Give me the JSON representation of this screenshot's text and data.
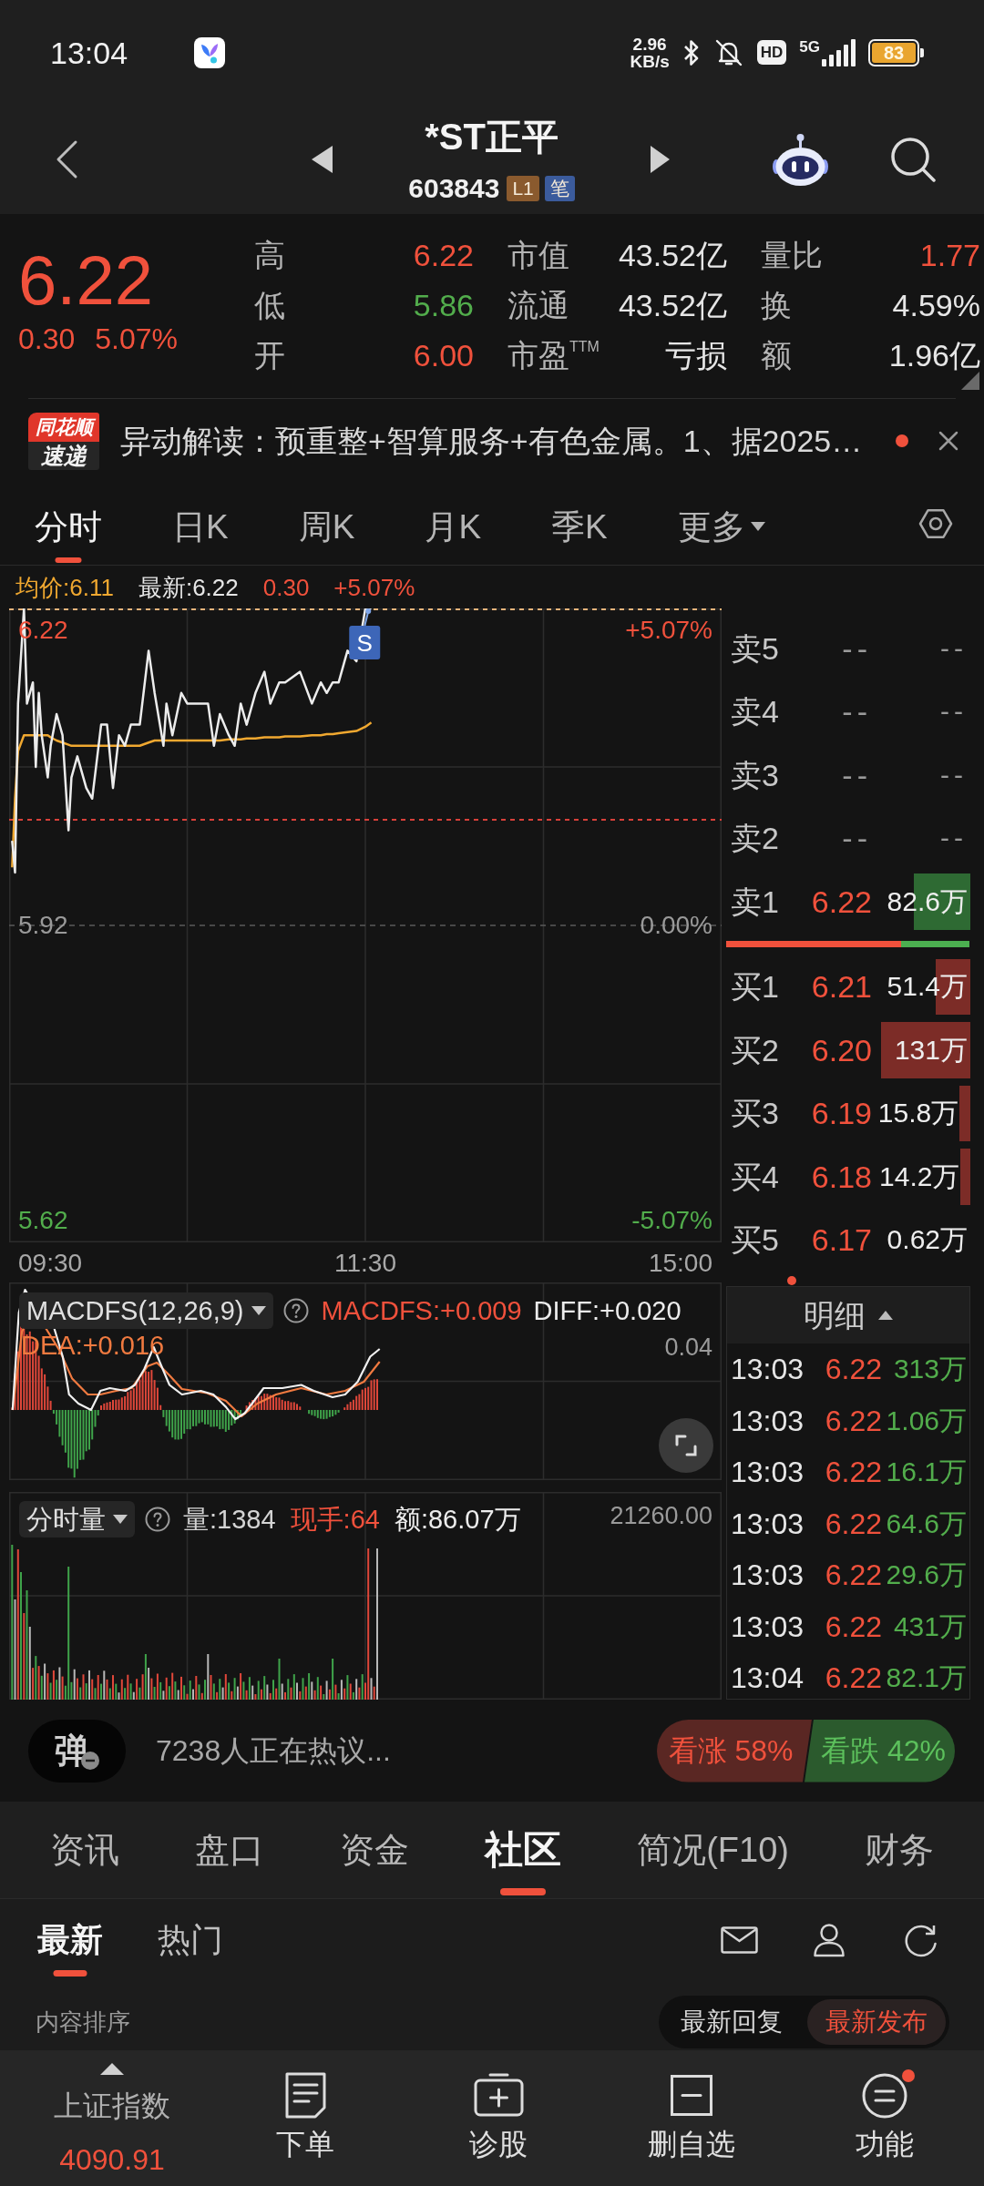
{
  "status_bar": {
    "time": "13:04",
    "net_speed": "2.96",
    "net_unit": "KB/s",
    "hd": "HD",
    "network": "5G",
    "battery": "83"
  },
  "header": {
    "title": "*ST正平",
    "code": "603843",
    "badges": [
      {
        "text": "L1",
        "color": "#8a5a2e"
      },
      {
        "text": "笔",
        "color": "#3b5b9c"
      }
    ]
  },
  "quote": {
    "price": "6.22",
    "change": "0.30",
    "change_pct": "5.07%",
    "stats": [
      {
        "label": "高",
        "value": "6.22",
        "color": "#f0513c"
      },
      {
        "label": "市值",
        "value": "43.52亿",
        "color": "#e6e6e6"
      },
      {
        "label": "量比",
        "value": "1.77",
        "color": "#f0513c"
      },
      {
        "label": "低",
        "value": "5.86",
        "color": "#52ad4c"
      },
      {
        "label": "流通",
        "value": "43.52亿",
        "color": "#e6e6e6"
      },
      {
        "label": "换",
        "value": "4.59%",
        "color": "#e6e6e6"
      },
      {
        "label": "开",
        "value": "6.00",
        "color": "#f0513c"
      },
      {
        "label": "市盈$^{TTM}$",
        "value": "亏损",
        "color": "#e6e6e6"
      },
      {
        "label": "额",
        "value": "1.96亿",
        "color": "#e6e6e6"
      }
    ]
  },
  "news": {
    "source_top": "同花顺",
    "source_bottom": "速递",
    "text": "异动解读：预重整+智算服务+有色金属。1、据2025…",
    "unread": true
  },
  "chart_tabs": [
    {
      "label": "分时",
      "selected": true,
      "has_menu": false
    },
    {
      "label": "日K",
      "selected": false,
      "has_menu": false
    },
    {
      "label": "周K",
      "selected": false,
      "has_menu": false
    },
    {
      "label": "月K",
      "selected": false,
      "has_menu": false
    },
    {
      "label": "季K",
      "selected": false,
      "has_menu": false
    },
    {
      "label": "更多",
      "selected": false,
      "has_menu": true
    }
  ],
  "intraday": {
    "legend": [
      {
        "text": "均价:6.11",
        "color": "#f0a830"
      },
      {
        "text": "最新:6.22",
        "color": "#e6e6e6"
      },
      {
        "text": "0.30",
        "color": "#f0513c"
      },
      {
        "text": "+5.07%",
        "color": "#f0513c"
      }
    ],
    "left_axis": [
      {
        "text": "6.22",
        "color": "#f0513c"
      },
      {
        "text": "5.92",
        "color": "#9a9a9a"
      },
      {
        "text": "5.62",
        "color": "#52ad4c"
      }
    ],
    "right_axis": [
      {
        "text": "+5.07%",
        "color": "#f0513c"
      },
      {
        "text": "0.00%",
        "color": "#9a9a9a"
      },
      {
        "text": "-5.07%",
        "color": "#52ad4c"
      }
    ],
    "time_axis": [
      "09:30",
      "11:30",
      "15:00"
    ],
    "marker": "S"
  },
  "order_book": {
    "asks": [
      {
        "label": "卖5",
        "price": "--",
        "volume": "--",
        "kind": "empty"
      },
      {
        "label": "卖4",
        "price": "--",
        "volume": "--",
        "kind": "empty"
      },
      {
        "label": "卖3",
        "price": "--",
        "volume": "--",
        "kind": "empty"
      },
      {
        "label": "卖2",
        "price": "--",
        "volume": "--",
        "kind": "empty"
      },
      {
        "label": "卖1",
        "price": "6.22",
        "volume": "82.6万",
        "kind": "quote"
      }
    ],
    "ratio": {
      "level": 0.72
    },
    "bids": [
      {
        "label": "买1",
        "price": "6.21",
        "volume": "51.4万",
        "kind": "quote"
      },
      {
        "label": "买2",
        "price": "6.20",
        "volume": "131万",
        "kind": "quote"
      },
      {
        "label": "买3",
        "price": "6.19",
        "volume": "15.8万",
        "kind": "quote"
      },
      {
        "label": "买4",
        "price": "6.18",
        "volume": "14.2万",
        "kind": "quote"
      },
      {
        "label": "买5",
        "price": "6.17",
        "volume": "0.62万",
        "kind": "quote"
      }
    ]
  },
  "macd": {
    "name": "MACDFS(12,26,9)",
    "values": [
      {
        "text": "MACDFS:+0.009",
        "color": "#f0513c"
      },
      {
        "text": "DIFF:+0.020",
        "color": "#ececec"
      },
      {
        "text": "DEA:+0.016",
        "color": "#f07a40"
      }
    ],
    "axis_label": "0.04"
  },
  "volume": {
    "name": "分时量",
    "values": [
      {
        "text": "量:1384",
        "color": "#d4d4d4"
      },
      {
        "text": "现手:64",
        "color": "#f0513c"
      },
      {
        "text": "额:86.07万",
        "color": "#ececec"
      }
    ],
    "axis_label": "21260.00"
  },
  "trades": {
    "title": "明细",
    "rows": [
      {
        "time": "13:03",
        "price": "6.22",
        "volume": "313万"
      },
      {
        "time": "13:03",
        "price": "6.22",
        "volume": "1.06万"
      },
      {
        "time": "13:03",
        "price": "6.22",
        "volume": "16.1万"
      },
      {
        "time": "13:03",
        "price": "6.22",
        "volume": "64.6万"
      },
      {
        "time": "13:03",
        "price": "6.22",
        "volume": "29.6万"
      },
      {
        "time": "13:03",
        "price": "6.22",
        "volume": "431万"
      },
      {
        "time": "13:04",
        "price": "6.22",
        "volume": "82.1万"
      }
    ]
  },
  "discussion": {
    "danmaku": "弹",
    "text": "7238人正在热议...",
    "bull": "看涨 58%",
    "bear": "看跌 42%"
  },
  "section_tabs": [
    {
      "label": "资讯",
      "selected": false
    },
    {
      "label": "盘口",
      "selected": false
    },
    {
      "label": "资金",
      "selected": false
    },
    {
      "label": "社区",
      "selected": true
    },
    {
      "label": "简况(F10)",
      "selected": false
    },
    {
      "label": "财务",
      "selected": false
    }
  ],
  "sub_tabs": [
    {
      "label": "最新",
      "selected": true
    },
    {
      "label": "热门",
      "selected": false
    }
  ],
  "sort": {
    "label": "内容排序",
    "options": [
      {
        "label": "最新回复",
        "selected": false
      },
      {
        "label": "最新发布",
        "selected": true
      }
    ]
  },
  "bottom_nav": {
    "index": {
      "name": "上证指数",
      "value": "4090.91"
    },
    "items": [
      {
        "label": "下单",
        "badge": false
      },
      {
        "label": "诊股",
        "badge": false
      },
      {
        "label": "删自选",
        "badge": false
      },
      {
        "label": "功能",
        "badge": true
      }
    ]
  }
}
